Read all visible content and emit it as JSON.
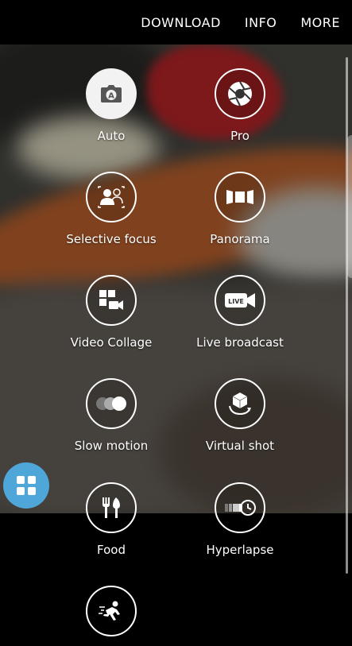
{
  "topbar": {
    "download": "DOWNLOAD",
    "info": "INFO",
    "more": "MORE"
  },
  "modes": [
    {
      "label": "Auto",
      "icon": "camera-auto-icon",
      "active": true
    },
    {
      "label": "Pro",
      "icon": "aperture-icon",
      "active": false
    },
    {
      "label": "Selective focus",
      "icon": "selective-focus-icon",
      "active": false
    },
    {
      "label": "Panorama",
      "icon": "panorama-icon",
      "active": false
    },
    {
      "label": "Video Collage",
      "icon": "video-collage-icon",
      "active": false
    },
    {
      "label": "Live broadcast",
      "icon": "live-broadcast-icon",
      "active": false
    },
    {
      "label": "Slow motion",
      "icon": "slow-motion-icon",
      "active": false
    },
    {
      "label": "Virtual shot",
      "icon": "virtual-shot-icon",
      "active": false
    },
    {
      "label": "Food",
      "icon": "food-icon",
      "active": false
    },
    {
      "label": "Hyperlapse",
      "icon": "hyperlapse-icon",
      "active": false
    },
    {
      "label": "",
      "icon": "sports-icon",
      "active": false
    }
  ],
  "live_badge": "LIVE",
  "auto_badge": "A",
  "colors": {
    "fab": "#4fa6d8",
    "background": "#000000"
  }
}
